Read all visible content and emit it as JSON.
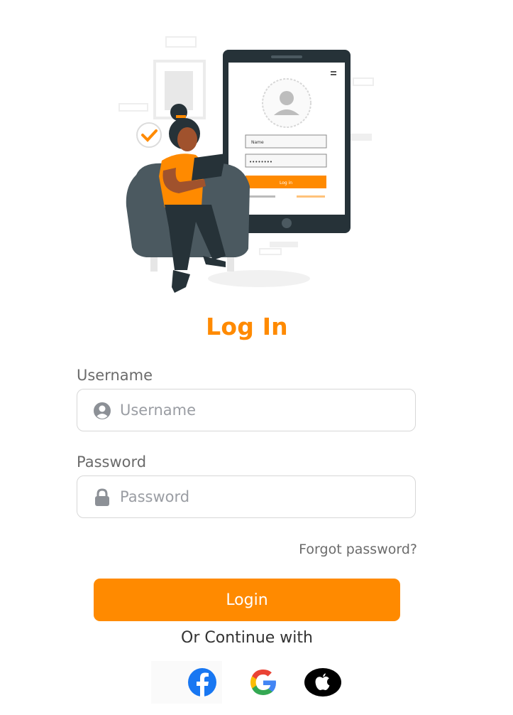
{
  "form": {
    "title": "Log In",
    "username": {
      "label": "Username",
      "placeholder": "Username",
      "value": ""
    },
    "password": {
      "label": "Password",
      "placeholder": "Password",
      "value": ""
    },
    "forgot_label": "Forgot password?",
    "login_label": "Login",
    "or_continue": "Or Continue with"
  },
  "illustration": {
    "screen_name_field": "Name",
    "screen_password_mask": "••••••••",
    "screen_login_label": "Log in"
  },
  "social": [
    {
      "name": "facebook",
      "icon": "facebook-icon"
    },
    {
      "name": "google",
      "icon": "google-icon"
    },
    {
      "name": "apple",
      "icon": "apple-icon"
    }
  ],
  "colors": {
    "accent": "#ff8a00",
    "label": "#6b6b6b",
    "border": "#d7d7d7",
    "facebook": "#1877f2"
  }
}
